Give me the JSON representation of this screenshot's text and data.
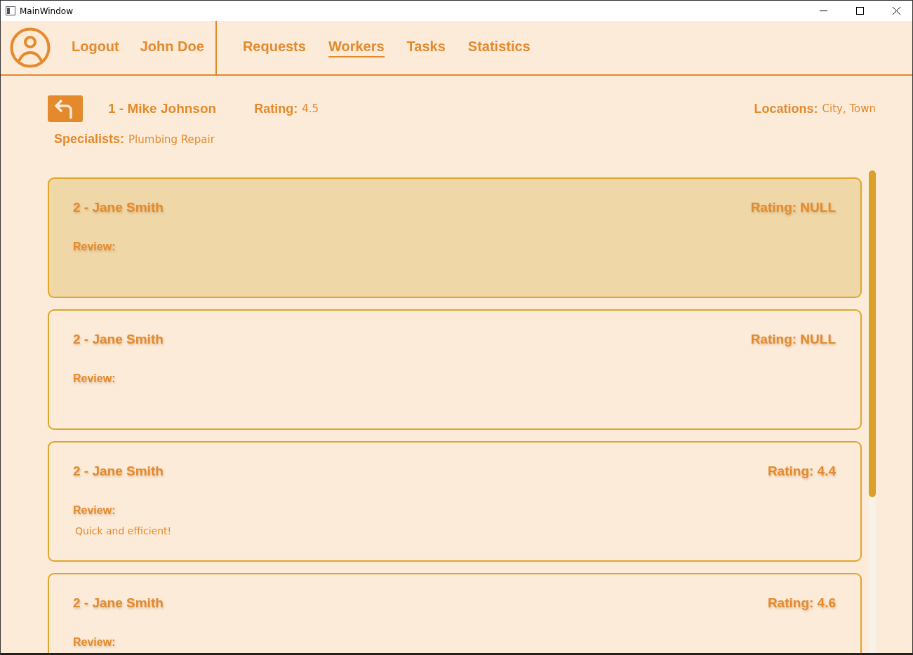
{
  "window": {
    "title": "MainWindow"
  },
  "header": {
    "logout": "Logout",
    "user": "John Doe",
    "tabs": [
      {
        "label": "Requests",
        "selected": false
      },
      {
        "label": "Workers",
        "selected": true
      },
      {
        "label": "Tasks",
        "selected": false
      },
      {
        "label": "Statistics",
        "selected": false
      }
    ]
  },
  "worker": {
    "name": "1 - Mike Johnson",
    "rating_label": "Rating:",
    "rating": "4.5",
    "locations_label": "Locations:",
    "locations": "City, Town",
    "specialists_label": "Specialists:",
    "specialists": "Plumbing Repair"
  },
  "reviews": [
    {
      "name": "2 - Jane Smith",
      "rating": "Rating: NULL",
      "review_label": "Review:",
      "selected": true
    },
    {
      "name": "2 - Jane Smith",
      "rating": "Rating: NULL",
      "review_label": "Review:",
      "selected": false
    },
    {
      "name": "2 - Jane Smith",
      "rating": "Rating: 4.4",
      "review_label": "Review:",
      "text": "Quick and efficient!",
      "selected": false
    },
    {
      "name": "2 - Jane Smith",
      "rating": "Rating: 4.6",
      "review_label": "Review:",
      "selected": false
    }
  ]
}
